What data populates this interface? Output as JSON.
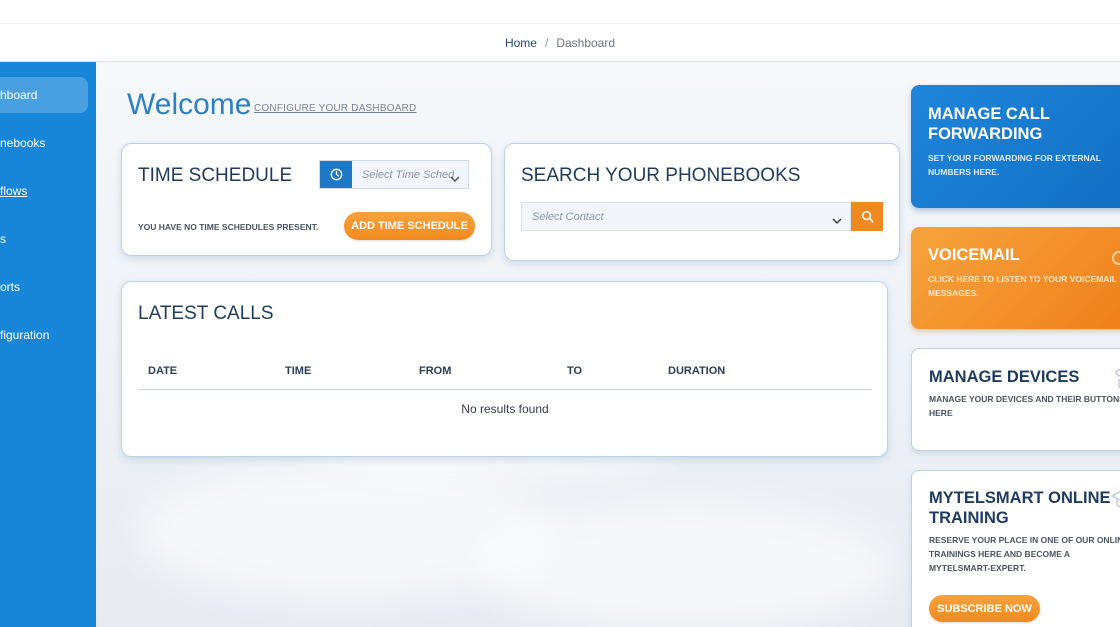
{
  "breadcrumb": {
    "home": "Home",
    "separator": "/",
    "current": "Dashboard"
  },
  "sidebar": {
    "items": [
      {
        "label": "hboard",
        "active": true
      },
      {
        "label": "nebooks"
      },
      {
        "label": "flows"
      },
      {
        "label": "s"
      },
      {
        "label": "orts"
      },
      {
        "label": "figuration"
      }
    ]
  },
  "welcome": {
    "title": "Welcome",
    "configure_link": "CONFIGURE YOUR DASHBOARD"
  },
  "time_schedule": {
    "title": "TIME SCHEDULE",
    "placeholder": "Select Time Schedule",
    "empty_text": "YOU HAVE NO TIME SCHEDULES PRESENT.",
    "add_button": "ADD TIME SCHEDULE"
  },
  "phonebook": {
    "title": "SEARCH YOUR PHONEBOOKS",
    "placeholder": "Select Contact"
  },
  "latest_calls": {
    "title": "LATEST CALLS",
    "columns": [
      "DATE",
      "TIME",
      "FROM",
      "TO",
      "DURATION"
    ],
    "empty_text": "No results found"
  },
  "tiles": {
    "forwarding": {
      "title_line1": "MANAGE CALL",
      "title_line2": "FORWARDING",
      "desc": "SET YOUR FORWARDING FOR EXTERNAL NUMBERS HERE."
    },
    "voicemail": {
      "title": "VOICEMAIL",
      "desc": "CLICK HERE TO LISTEN TO YOUR VOICEMAIL MESSAGES."
    },
    "devices": {
      "title": "MANAGE DEVICES",
      "desc": "MANAGE YOUR DEVICES AND THEIR BUTTONS HERE"
    },
    "training": {
      "title_line1": "MYTELSMART ONLINE",
      "title_line2": "TRAINING",
      "desc": "RESERVE YOUR PLACE IN ONE OF OUR ONLINE TRAININGS HERE AND BECOME A MYTELSMART-EXPERT.",
      "button": "SUBSCRIBE NOW"
    }
  },
  "colors": {
    "primary": "#1786d9",
    "accent": "#f08a1e",
    "heading": "#1f3b5f"
  }
}
